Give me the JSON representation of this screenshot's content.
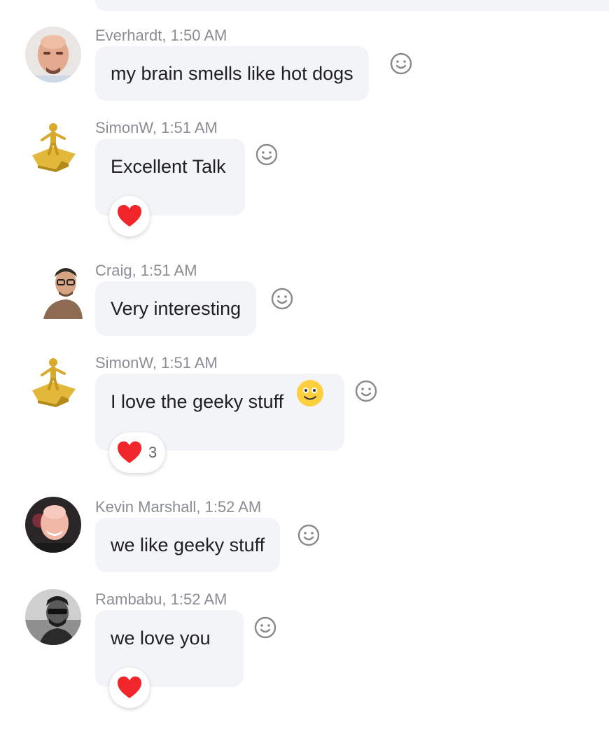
{
  "messages": [
    {
      "author_time": "Everhardt, 1:50 AM",
      "text": "my brain smells like hot dogs"
    },
    {
      "author_time": "SimonW, 1:51 AM",
      "text": "Excellent Talk",
      "reaction": {
        "emoji": "heart",
        "count": ""
      }
    },
    {
      "author_time": "Craig, 1:51 AM",
      "text": "Very interesting"
    },
    {
      "author_time": "SimonW, 1:51 AM",
      "text": "I love the geeky stuff",
      "inline_emoji": "smiley-face",
      "reaction": {
        "emoji": "heart",
        "count": "3"
      }
    },
    {
      "author_time": "Kevin Marshall, 1:52 AM",
      "text": "we like geeky stuff"
    },
    {
      "author_time": "Rambabu, 1:52 AM",
      "text": "we love you",
      "reaction": {
        "emoji": "heart",
        "count": ""
      }
    }
  ],
  "icons": {
    "add_reaction": "smiley-outline-icon",
    "reaction_heart": "heart-icon"
  },
  "colors": {
    "bubble": "#f2f4f7",
    "meta_text": "#8a8d91",
    "heart": "#f0262b",
    "emoji_face": "#ffcf3f"
  }
}
